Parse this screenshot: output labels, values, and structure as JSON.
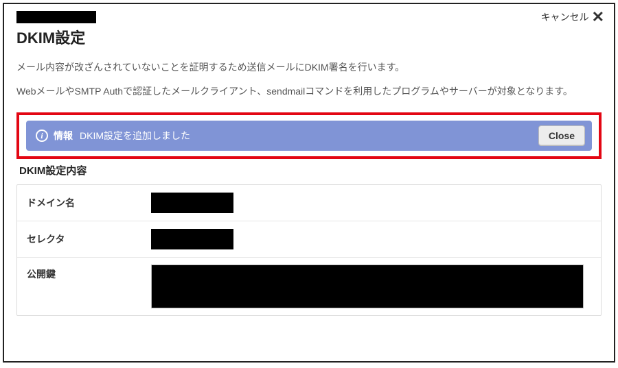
{
  "header": {
    "cancel_label": "キャンセル"
  },
  "page": {
    "title": "DKIM設定",
    "desc_line1": "メール内容が改ざんされていないことを証明するため送信メールにDKIM署名を行います。",
    "desc_line2": "WebメールやSMTP Authで認証したメールクライアント、sendmailコマンドを利用したプログラムやサーバーが対象となります。"
  },
  "banner": {
    "label": "情報",
    "message": "DKIM設定を追加しました",
    "close_label": "Close"
  },
  "section": {
    "title": "DKIM設定内容",
    "rows": {
      "domain_label": "ドメイン名",
      "selector_label": "セレクタ",
      "pubkey_label": "公開鍵"
    }
  }
}
